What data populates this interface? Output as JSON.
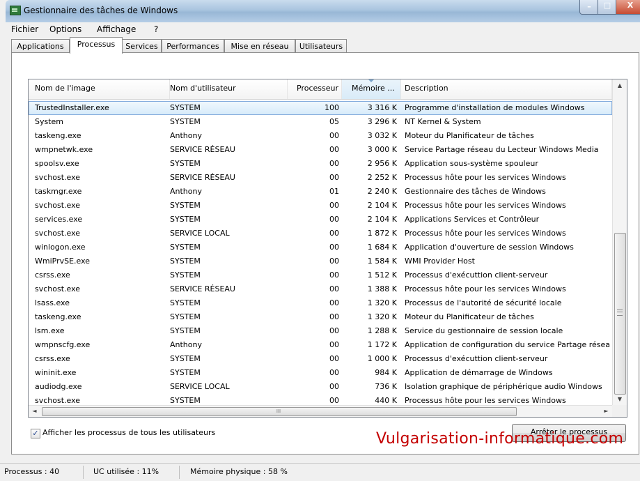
{
  "window": {
    "title": "Gestionnaire des tâches de Windows",
    "controls": {
      "minimize": "–",
      "maximize": "□",
      "close": "X"
    }
  },
  "menu": [
    "Fichier",
    "Options",
    "Affichage",
    "?"
  ],
  "tabs": [
    "Applications",
    "Processus",
    "Services",
    "Performances",
    "Mise en réseau",
    "Utilisateurs"
  ],
  "active_tab": "Processus",
  "columns": {
    "name": "Nom de l'image",
    "user": "Nom d'utilisateur",
    "cpu": "Processeur",
    "memory": "Mémoire ...",
    "description": "Description"
  },
  "sorted_column": "memory",
  "processes": [
    {
      "name": "TrustedInstaller.exe",
      "user": "SYSTEM",
      "cpu": "100",
      "mem": "3 316 K",
      "desc": "Programme d'installation de modules Windows"
    },
    {
      "name": "System",
      "user": "SYSTEM",
      "cpu": "05",
      "mem": "3 296 K",
      "desc": "NT Kernel & System"
    },
    {
      "name": "taskeng.exe",
      "user": "Anthony",
      "cpu": "00",
      "mem": "3 032 K",
      "desc": "Moteur du Planificateur de tâches"
    },
    {
      "name": "wmpnetwk.exe",
      "user": "SERVICE RÉSEAU",
      "cpu": "00",
      "mem": "3 000 K",
      "desc": "Service Partage réseau du Lecteur Windows Media"
    },
    {
      "name": "spoolsv.exe",
      "user": "SYSTEM",
      "cpu": "00",
      "mem": "2 956 K",
      "desc": "Application sous-système spouleur"
    },
    {
      "name": "svchost.exe",
      "user": "SERVICE RÉSEAU",
      "cpu": "00",
      "mem": "2 252 K",
      "desc": "Processus hôte pour les services Windows"
    },
    {
      "name": "taskmgr.exe",
      "user": "Anthony",
      "cpu": "01",
      "mem": "2 240 K",
      "desc": "Gestionnaire des tâches de Windows"
    },
    {
      "name": "svchost.exe",
      "user": "SYSTEM",
      "cpu": "00",
      "mem": "2 104 K",
      "desc": "Processus hôte pour les services Windows"
    },
    {
      "name": "services.exe",
      "user": "SYSTEM",
      "cpu": "00",
      "mem": "2 104 K",
      "desc": "Applications Services et Contrôleur"
    },
    {
      "name": "svchost.exe",
      "user": "SERVICE LOCAL",
      "cpu": "00",
      "mem": "1 872 K",
      "desc": "Processus hôte pour les services Windows"
    },
    {
      "name": "winlogon.exe",
      "user": "SYSTEM",
      "cpu": "00",
      "mem": "1 684 K",
      "desc": "Application d'ouverture de session Windows"
    },
    {
      "name": "WmiPrvSE.exe",
      "user": "SYSTEM",
      "cpu": "00",
      "mem": "1 584 K",
      "desc": "WMI Provider Host"
    },
    {
      "name": "csrss.exe",
      "user": "SYSTEM",
      "cpu": "00",
      "mem": "1 512 K",
      "desc": "Processus d'exécuttion client-serveur"
    },
    {
      "name": "svchost.exe",
      "user": "SERVICE RÉSEAU",
      "cpu": "00",
      "mem": "1 388 K",
      "desc": "Processus hôte pour les services Windows"
    },
    {
      "name": "lsass.exe",
      "user": "SYSTEM",
      "cpu": "00",
      "mem": "1 320 K",
      "desc": "Processus de l'autorité de sécurité locale"
    },
    {
      "name": "taskeng.exe",
      "user": "SYSTEM",
      "cpu": "00",
      "mem": "1 320 K",
      "desc": "Moteur du Planificateur de tâches"
    },
    {
      "name": "lsm.exe",
      "user": "SYSTEM",
      "cpu": "00",
      "mem": "1 288 K",
      "desc": "Service du gestionnaire de session locale"
    },
    {
      "name": "wmpnscfg.exe",
      "user": "Anthony",
      "cpu": "00",
      "mem": "1 172 K",
      "desc": "Application de configuration du service Partage résea"
    },
    {
      "name": "csrss.exe",
      "user": "SYSTEM",
      "cpu": "00",
      "mem": "1 000 K",
      "desc": "Processus d'exécuttion client-serveur"
    },
    {
      "name": "wininit.exe",
      "user": "SYSTEM",
      "cpu": "00",
      "mem": "984 K",
      "desc": "Application de démarrage de Windows"
    },
    {
      "name": "audiodg.exe",
      "user": "SERVICE LOCAL",
      "cpu": "00",
      "mem": "736 K",
      "desc": "Isolation graphique de périphérique audio Windows"
    },
    {
      "name": "svchost.exe",
      "user": "SYSTEM",
      "cpu": "00",
      "mem": "440 K",
      "desc": "Processus hôte pour les services Windows"
    }
  ],
  "selected_row": 0,
  "scroll": {
    "up": "▲",
    "down": "▼",
    "left": "◄",
    "right": "►",
    "grip": "III"
  },
  "show_all_checkbox": {
    "label": "Afficher les processus de tous les utilisateurs",
    "checked": true,
    "mark": "✓"
  },
  "end_process_button": "Arrêter le processus",
  "watermark": "Vulgarisation-informatique.com",
  "status": {
    "processes": "Processus : 40",
    "cpu": "UC utilisée : 11%",
    "memory": "Mémoire physique : 58 %"
  },
  "colors": {
    "watermark": "#c40000",
    "selection": "#d6ebfa",
    "titlebar": "#a9c4df"
  }
}
